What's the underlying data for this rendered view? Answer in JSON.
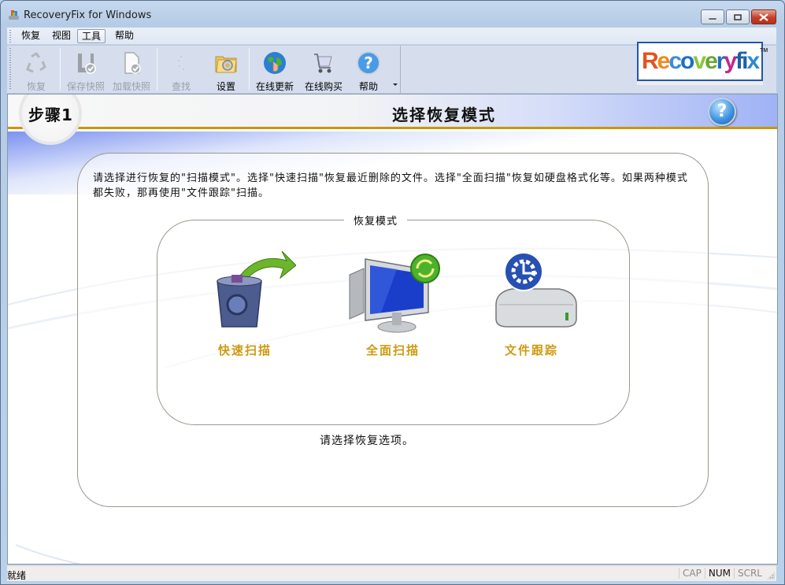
{
  "window": {
    "title": "RecoveryFix for Windows",
    "controls": {
      "minimize": "minimize",
      "maximize": "maximize",
      "close": "close"
    }
  },
  "menu": {
    "items": [
      {
        "label": "恢复"
      },
      {
        "label": "视图"
      },
      {
        "label": "工具",
        "active": true
      },
      {
        "label": "帮助"
      }
    ]
  },
  "toolbar": {
    "buttons": [
      {
        "label": "恢复",
        "icon": "recycle-icon",
        "enabled": false
      },
      {
        "label": "保存快照",
        "icon": "save-snapshot-icon",
        "enabled": false
      },
      {
        "label": "加载快照",
        "icon": "load-snapshot-icon",
        "enabled": false
      },
      {
        "label": "查找",
        "icon": "search-icon",
        "enabled": false
      },
      {
        "label": "设置",
        "icon": "settings-folder-icon",
        "enabled": true
      },
      {
        "label": "在线更新",
        "icon": "globe-update-icon",
        "enabled": true
      },
      {
        "label": "在线购买",
        "icon": "cart-icon",
        "enabled": true
      },
      {
        "label": "帮助",
        "icon": "help-icon",
        "enabled": true
      }
    ]
  },
  "logo": {
    "letters": [
      {
        "ch": "R",
        "color": "#e2541f"
      },
      {
        "ch": "e",
        "color": "#f08a1c"
      },
      {
        "ch": "c",
        "color": "#3a8dd8"
      },
      {
        "ch": "o",
        "color": "#1d6fc1"
      },
      {
        "ch": "v",
        "color": "#8cc63f"
      },
      {
        "ch": "e",
        "color": "#6aa531"
      },
      {
        "ch": "r",
        "color": "#1d6fc1"
      },
      {
        "ch": "y",
        "color": "#c3288b"
      },
      {
        "ch": "f",
        "color": "#1d5fa8"
      },
      {
        "ch": "i",
        "color": "#1d5fa8"
      },
      {
        "ch": "x",
        "color": "#2a8ad0"
      }
    ],
    "tm": "TM"
  },
  "step": {
    "label": "步骤1",
    "title": "选择恢复模式",
    "help": "?"
  },
  "main": {
    "description": "请选择进行恢复的\"扫描模式\"。选择\"快速扫描\"恢复最近删除的文件。选择\"全面扫描\"恢复如硬盘格式化等。如果两种模式都失败，那再使用\"文件跟踪\"扫描。",
    "group_label": "恢复模式",
    "modes": [
      {
        "label": "快速扫描",
        "icon": "recycle-bin-arrow-icon"
      },
      {
        "label": "全面扫描",
        "icon": "monitor-refresh-icon"
      },
      {
        "label": "文件跟踪",
        "icon": "drive-trace-icon"
      }
    ],
    "hint": "请选择恢复选项。"
  },
  "status": {
    "text": "就绪",
    "indicators": [
      {
        "label": "CAP",
        "on": false
      },
      {
        "label": "NUM",
        "on": true
      },
      {
        "label": "SCRL",
        "on": false
      }
    ]
  },
  "colors": {
    "accent_gold": "#cb9606",
    "mode_label": "#cf9a10",
    "header_blue": "#9fb2f6"
  }
}
